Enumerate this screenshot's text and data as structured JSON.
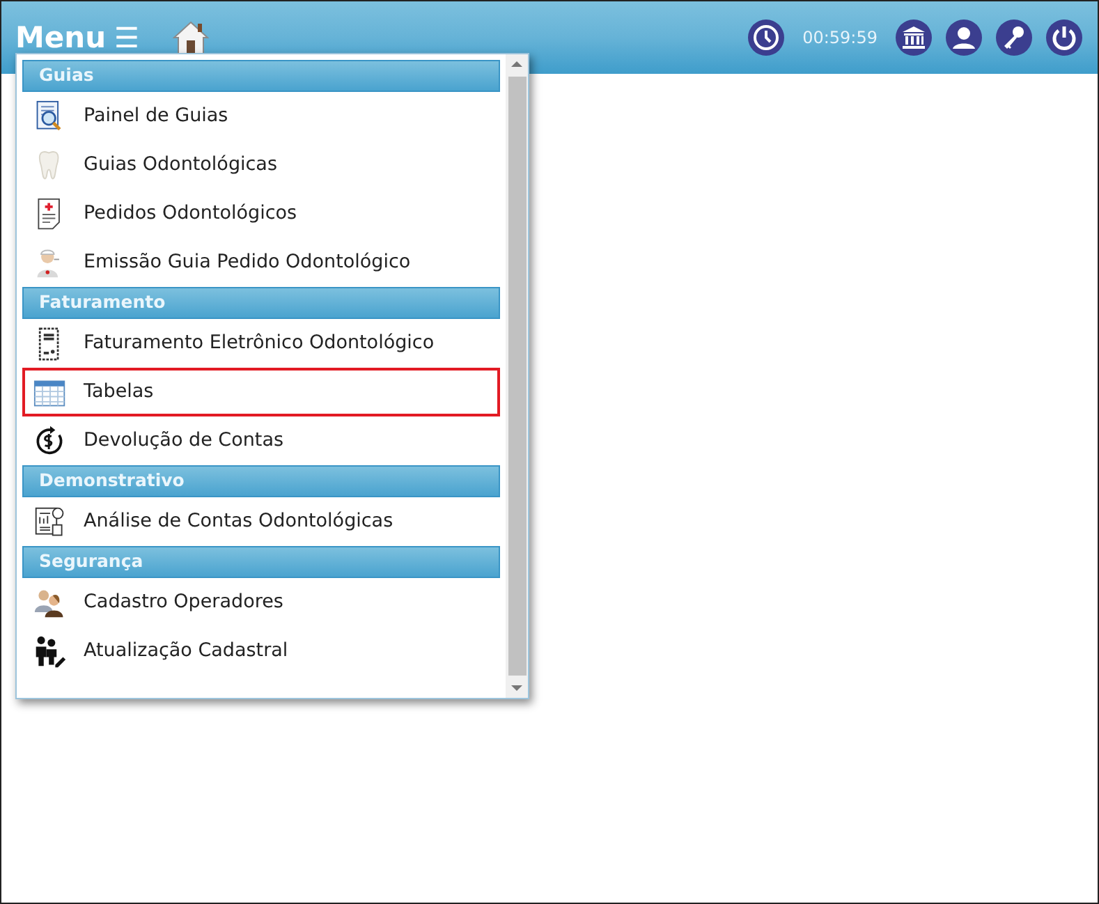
{
  "header": {
    "title": "Menu",
    "menu_icon": "☰",
    "timer": "00:59:59"
  },
  "menu": {
    "sections": [
      {
        "title": "Guias",
        "items": [
          {
            "label": "Painel de Guias",
            "highlighted": false
          },
          {
            "label": "Guias Odontológicas",
            "highlighted": false
          },
          {
            "label": "Pedidos Odontológicos",
            "highlighted": false
          },
          {
            "label": "Emissão Guia Pedido Odontológico",
            "highlighted": false
          }
        ]
      },
      {
        "title": "Faturamento",
        "items": [
          {
            "label": "Faturamento Eletrônico Odontológico",
            "highlighted": false
          },
          {
            "label": "Tabelas",
            "highlighted": true
          },
          {
            "label": "Devolução de Contas",
            "highlighted": false
          }
        ]
      },
      {
        "title": "Demonstrativo",
        "items": [
          {
            "label": "Análise de Contas Odontológicas",
            "highlighted": false
          }
        ]
      },
      {
        "title": "Segurança",
        "items": [
          {
            "label": "Cadastro Operadores",
            "highlighted": false
          },
          {
            "label": "Atualização Cadastral",
            "highlighted": false
          }
        ]
      }
    ]
  }
}
